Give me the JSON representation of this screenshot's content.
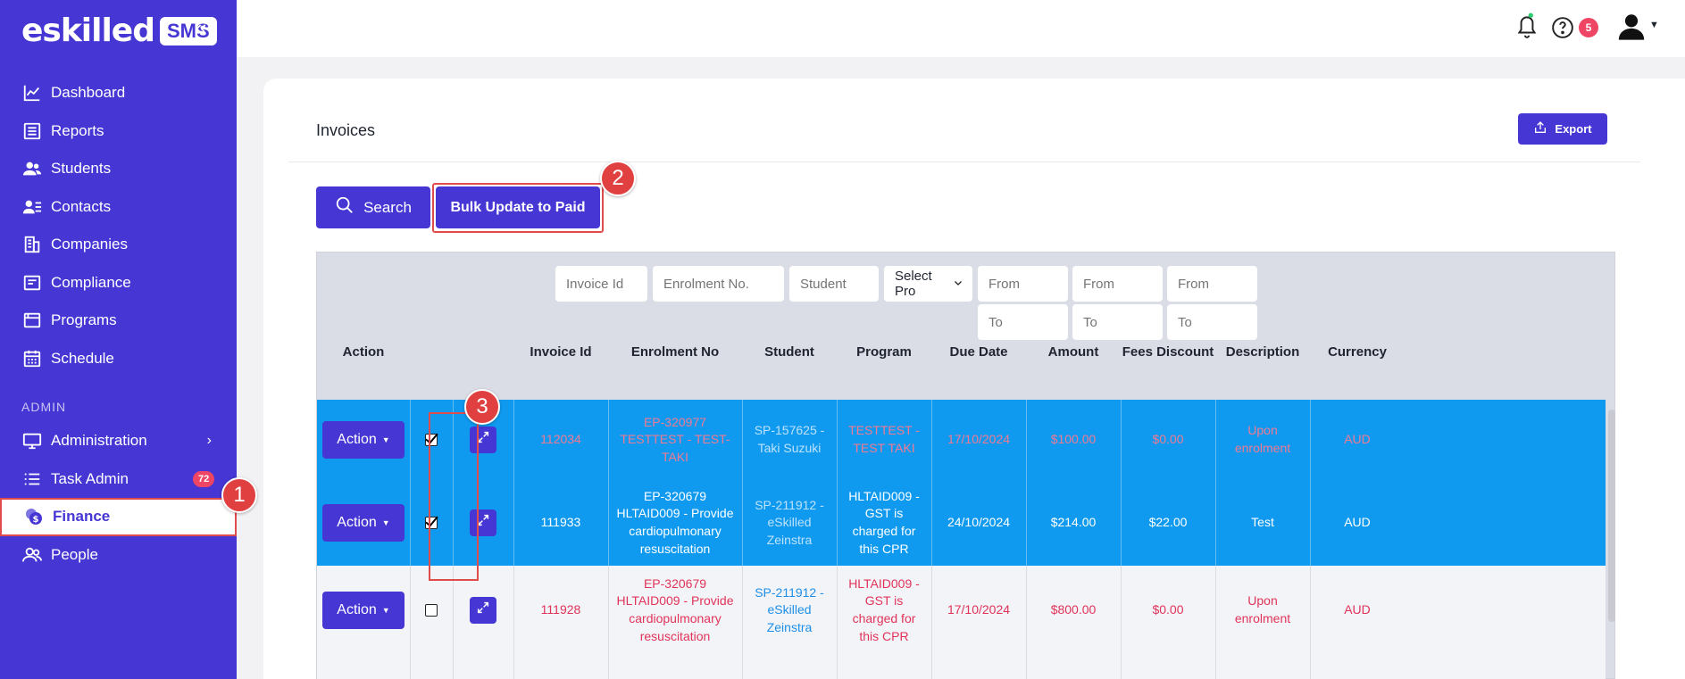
{
  "app": {
    "logo_text": "eskilled",
    "logo_badge": "SMS",
    "collapse_icon": "«"
  },
  "sidebar": {
    "items": [
      {
        "label": "Dashboard",
        "icon": "chart-line-icon"
      },
      {
        "label": "Reports",
        "icon": "reports-icon"
      },
      {
        "label": "Students",
        "icon": "students-icon"
      },
      {
        "label": "Contacts",
        "icon": "contacts-icon"
      },
      {
        "label": "Companies",
        "icon": "companies-icon"
      },
      {
        "label": "Compliance",
        "icon": "compliance-icon"
      },
      {
        "label": "Programs",
        "icon": "programs-icon"
      },
      {
        "label": "Schedule",
        "icon": "calendar-icon"
      }
    ],
    "section_label": "ADMIN",
    "admin_items": [
      {
        "label": "Administration",
        "icon": "monitor-icon"
      },
      {
        "label": "Task Admin",
        "icon": "task-list-icon",
        "badge": "72"
      },
      {
        "label": "Finance",
        "icon": "finance-icon",
        "active": true
      },
      {
        "label": "People",
        "icon": "people-icon"
      }
    ]
  },
  "topbar": {
    "notification_badge": "5"
  },
  "page": {
    "title": "Invoices",
    "export_label": "Export",
    "search_label": "Search",
    "bulk_update_label": "Bulk Update to Paid"
  },
  "markers": {
    "m1": "1",
    "m2": "2",
    "m3": "3"
  },
  "filters": {
    "invoice_id": "Invoice Id",
    "enrolment_no": "Enrolment No.",
    "student": "Student",
    "program": "Select Pro",
    "due_from": "From",
    "due_to": "To",
    "amount_from": "From",
    "amount_to": "To",
    "discount_from": "From",
    "discount_to": "To"
  },
  "columns": {
    "action": "Action",
    "invoice_id": "Invoice Id",
    "enrolment_no": "Enrolment No",
    "student": "Student",
    "program": "Program",
    "due_date": "Due Date",
    "amount": "Amount",
    "fees_discount": "Fees Discount",
    "description": "Description",
    "currency": "Currency"
  },
  "rows": [
    {
      "action": "Action",
      "checked": true,
      "invoice_id": "112034",
      "enrolment": "EP-320977 TESTTEST - TEST-TAKI",
      "student": "SP-157625 - Taki Suzuki",
      "program": "TESTTEST - TEST TAKI",
      "due_date": "17/10/2024",
      "amount": "$100.00",
      "discount": "$0.00",
      "description": "Upon enrolment",
      "currency": "AUD"
    },
    {
      "action": "Action",
      "checked": true,
      "invoice_id": "111933",
      "enrolment": "EP-320679 HLTAID009 - Provide cardiopulmonary resuscitation",
      "student": "SP-211912 - eSkilled Zeinstra",
      "program": "HLTAID009 - GST is charged for this CPR",
      "due_date": "24/10/2024",
      "amount": "$214.00",
      "discount": "$22.00",
      "description": "Test",
      "currency": "AUD"
    },
    {
      "action": "Action",
      "checked": false,
      "invoice_id": "111928",
      "enrolment": "EP-320679 HLTAID009 - Provide cardiopulmonary resuscitation",
      "student": "SP-211912 - eSkilled Zeinstra",
      "program": "HLTAID009 - GST is charged for this CPR",
      "due_date": "17/10/2024",
      "amount": "$800.00",
      "discount": "$0.00",
      "description": "Upon enrolment",
      "currency": "AUD"
    }
  ]
}
